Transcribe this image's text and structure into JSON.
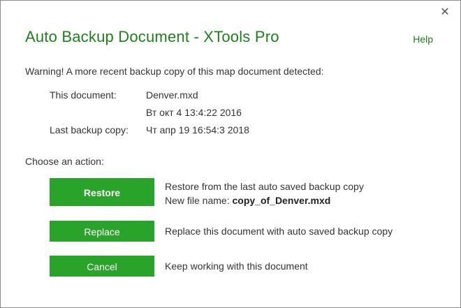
{
  "dialog": {
    "title": "Auto Backup Document - XTools Pro",
    "help": "Help",
    "close_icon": "close-icon",
    "warning": "Warning! A more recent backup copy of this map document detected:",
    "this_document_label": "This document:",
    "this_document_name": "Denver.mxd",
    "this_document_date": "Вт окт 4 13:4:22 2016",
    "backup_label": "Last backup copy:",
    "backup_date": "Чт апр 19 16:54:3 2018",
    "choose_action": "Choose an action:",
    "restore": {
      "label": "Restore",
      "desc_line1": "Restore from the last auto saved backup copy",
      "desc_prefix": "New file name: ",
      "desc_filename": "copy_of_Denver.mxd"
    },
    "replace": {
      "label": "Replace",
      "desc": "Replace this document with auto saved backup copy"
    },
    "cancel": {
      "label": "Cancel",
      "desc": "Keep working with this document"
    },
    "colors": {
      "accent_green": "#2aa32a",
      "title_green": "#1e7f1e"
    }
  }
}
